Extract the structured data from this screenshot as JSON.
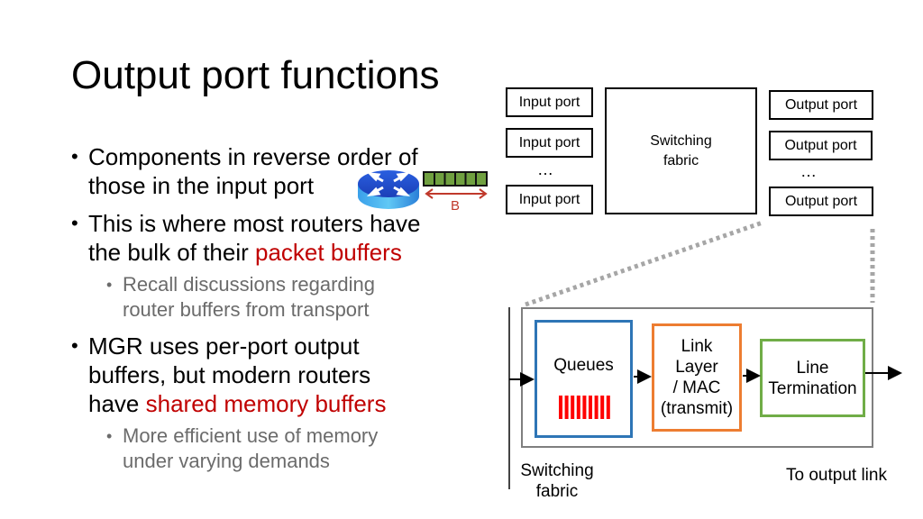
{
  "slide": {
    "title": "Output port functions",
    "bullets": [
      {
        "text": "Components in reverse order of those in the input port"
      },
      {
        "text_plain": "This is where most routers have the bulk of their ",
        "text_highlight": "packet buffers"
      },
      {
        "sub": "Recall discussions regarding router buffers from transport"
      },
      {
        "text_plain": "MGR uses per-port output buffers, but modern routers have ",
        "text_highlight": "shared memory buffers"
      },
      {
        "sub": "More efficient use of memory under varying demands"
      }
    ],
    "lines": {
      "b1_l1": "Components in reverse order of",
      "b1_l2": "those in the input port",
      "b2_l1": "This is where most routers have",
      "b2_l2_plain": "the bulk of their ",
      "b2_l2_red": "packet buffers",
      "s1_l1": "Recall discussions regarding",
      "s1_l2": "router buffers from transport",
      "b3_l1": "MGR uses per-port output",
      "b3_l2": "buffers, but modern routers",
      "b3_l3_plain": "have ",
      "b3_l3_red": "shared memory buffers",
      "s2_l1": "More efficient use of memory",
      "s2_l2": "under varying demands",
      "bullet_glyph": "•"
    },
    "buffer_label": "B",
    "icons": {
      "router": "router-icon",
      "buffer": "packet-buffer-icon"
    }
  },
  "router_diagram": {
    "input_ports": [
      "Input port",
      "Input port",
      "Input port"
    ],
    "output_ports": [
      "Output port",
      "Output port",
      "Output port"
    ],
    "ellipsis": "…",
    "fabric": {
      "line1": "Switching",
      "line2": "fabric"
    }
  },
  "output_port_detail": {
    "queues": {
      "label": "Queues",
      "packet_count": 9
    },
    "link_layer": {
      "l1": "Link",
      "l2": "Layer",
      "l3": "/ MAC",
      "l4": "(transmit)"
    },
    "line_termination": {
      "l1": "Line",
      "l2": "Termination"
    },
    "fabric_label": {
      "l1": "Switching",
      "l2": "fabric"
    },
    "output_label": "To output link"
  },
  "colors": {
    "highlight_red": "#c00000",
    "sub_gray": "#6b6b6b",
    "queues_border": "#2e75b6",
    "link_layer_border": "#ed7d31",
    "line_term_border": "#70ad47",
    "packet_red": "#ff0000",
    "buffer_green": "#70a040",
    "dotted_gray": "#a6a6a6"
  }
}
